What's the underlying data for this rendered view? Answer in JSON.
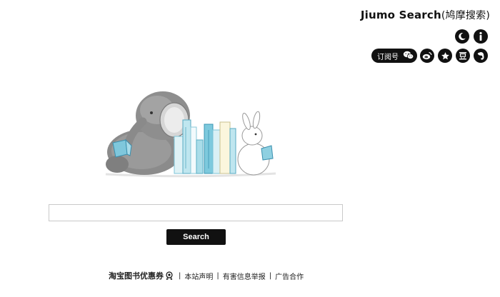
{
  "header": {
    "brand": "Jiumo Search",
    "brand_cn": "(鸠摩搜索)",
    "subscribe_label": "订阅号",
    "icons": [
      "moon-icon",
      "info-icon",
      "wechat-icon",
      "weibo-icon",
      "star-icon",
      "douban-icon",
      "evernote-icon"
    ]
  },
  "search": {
    "input_value": "",
    "input_placeholder": "",
    "button_label": "Search"
  },
  "footer": {
    "coupon_label": "淘宝图书优惠券",
    "links": [
      "本站声明",
      "有害信息举报",
      "广告合作"
    ],
    "separator": "|"
  }
}
